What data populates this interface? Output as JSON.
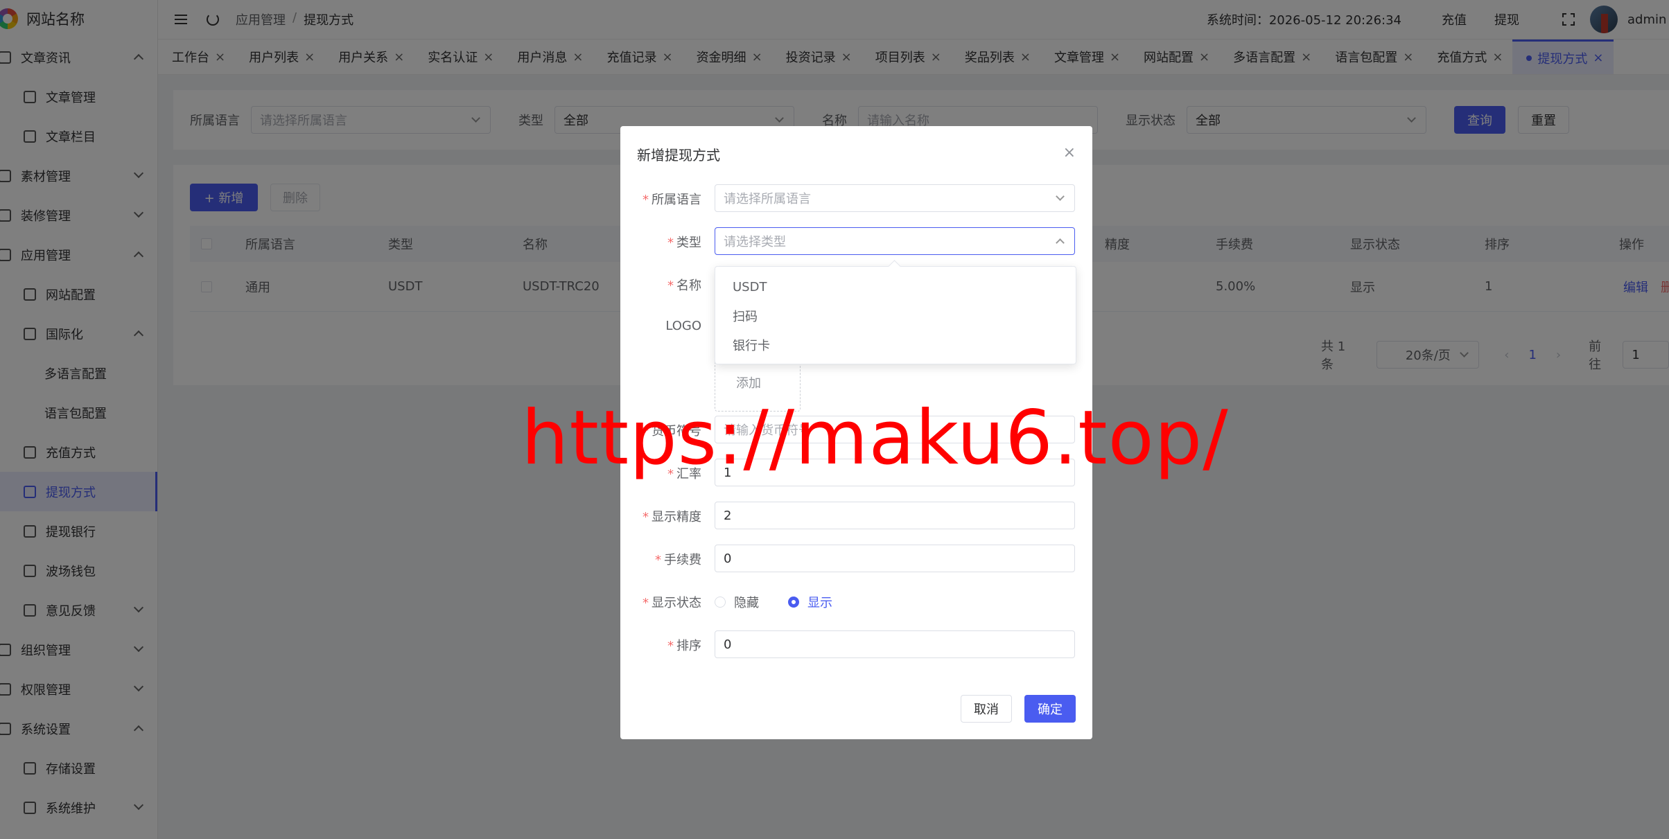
{
  "brand": {
    "name": "网站名称"
  },
  "sidebar": {
    "items": [
      {
        "label": "文章资讯",
        "level": 0,
        "arrow": "up",
        "icon": "article-icon"
      },
      {
        "label": "文章管理",
        "level": 1,
        "icon": "chat-icon"
      },
      {
        "label": "文章栏目",
        "level": 1,
        "icon": "bookmark-icon"
      },
      {
        "label": "素材管理",
        "level": 0,
        "arrow": "down",
        "icon": "image-icon"
      },
      {
        "label": "装修管理",
        "level": 0,
        "arrow": "down",
        "icon": "brush-icon"
      },
      {
        "label": "应用管理",
        "level": 0,
        "arrow": "up",
        "icon": "app-icon"
      },
      {
        "label": "网站配置",
        "level": 1,
        "icon": "globe-icon"
      },
      {
        "label": "国际化",
        "level": 1,
        "arrow": "up",
        "icon": "language-icon"
      },
      {
        "label": "多语言配置",
        "level": 2
      },
      {
        "label": "语言包配置",
        "level": 2
      },
      {
        "label": "充值方式",
        "level": 1,
        "icon": "recharge-icon"
      },
      {
        "label": "提现方式",
        "level": 1,
        "icon": "withdraw-icon",
        "active": true
      },
      {
        "label": "提现银行",
        "level": 1,
        "icon": "card-icon"
      },
      {
        "label": "波场钱包",
        "level": 1,
        "icon": "wallet-icon"
      },
      {
        "label": "意见反馈",
        "level": 1,
        "arrow": "down",
        "icon": "feedback-icon"
      },
      {
        "label": "组织管理",
        "level": 0,
        "arrow": "down",
        "icon": "org-icon"
      },
      {
        "label": "权限管理",
        "level": 0,
        "arrow": "down",
        "icon": "lock-icon"
      },
      {
        "label": "系统设置",
        "level": 0,
        "arrow": "up",
        "icon": "gear-icon"
      },
      {
        "label": "存储设置",
        "level": 1,
        "icon": "folder-icon"
      },
      {
        "label": "系统维护",
        "level": 1,
        "arrow": "down",
        "icon": "maintenance-icon"
      }
    ]
  },
  "header": {
    "breadcrumb": [
      "应用管理",
      "提现方式"
    ],
    "sys_time": "系统时间：2026-05-12 20:26:34",
    "recharge": "充值",
    "withdraw": "提现",
    "user": "admin"
  },
  "tabs": [
    {
      "label": "工作台"
    },
    {
      "label": "用户列表"
    },
    {
      "label": "用户关系"
    },
    {
      "label": "实名认证"
    },
    {
      "label": "用户消息"
    },
    {
      "label": "充值记录"
    },
    {
      "label": "资金明细"
    },
    {
      "label": "投资记录"
    },
    {
      "label": "项目列表"
    },
    {
      "label": "奖品列表"
    },
    {
      "label": "文章管理"
    },
    {
      "label": "网站配置"
    },
    {
      "label": "多语言配置"
    },
    {
      "label": "语言包配置"
    },
    {
      "label": "充值方式"
    },
    {
      "label": "提现方式",
      "active": true
    }
  ],
  "search": {
    "lang_label": "所属语言",
    "lang_placeholder": "请选择所属语言",
    "type_label": "类型",
    "type_value": "全部",
    "name_label": "名称",
    "name_placeholder": "请输入名称",
    "status_label": "显示状态",
    "status_value": "全部",
    "query": "查询",
    "reset": "重置"
  },
  "table": {
    "add": "+ 新增",
    "delete": "删除",
    "headers": [
      "所属语言",
      "类型",
      "名称",
      "精度",
      "手续费",
      "显示状态",
      "排序",
      "操作"
    ],
    "rows": [
      {
        "lang": "通用",
        "type": "USDT",
        "name": "USDT-TRC20",
        "fee": "5.00%",
        "status": "显示",
        "sort": "1",
        "edit": "编辑",
        "del": "删除"
      }
    ],
    "total": "共 1 条",
    "page_size": "20条/页",
    "page": "1",
    "goto": "前往",
    "goto_value": "1"
  },
  "dialog": {
    "title": "新增提现方式",
    "close": "×",
    "lang_label": "所属语言",
    "lang_placeholder": "请选择所属语言",
    "type_label": "类型",
    "type_placeholder": "请选择类型",
    "name_label": "名称",
    "logo_label": "LOGO",
    "upload_text": "添加",
    "currency_label": "货币符号",
    "currency_placeholder": "请输入货币符号",
    "rate_label": "汇率",
    "rate_value": "1",
    "precision_label": "显示精度",
    "precision_value": "2",
    "fee_label": "手续费",
    "fee_value": "0",
    "status_label": "显示状态",
    "hide": "隐藏",
    "show": "显示",
    "sort_label": "排序",
    "sort_value": "0",
    "cancel": "取消",
    "confirm": "确定"
  },
  "type_dropdown": {
    "options": [
      "USDT",
      "扫码",
      "银行卡"
    ]
  },
  "watermark": "https://maku6.top/",
  "colors": {
    "accent": "#4a5cf0",
    "danger": "#f56c6c",
    "watermark": "#ff0000"
  }
}
